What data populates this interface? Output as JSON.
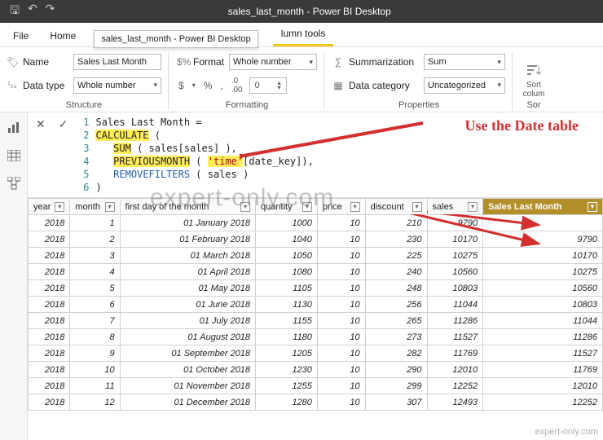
{
  "titlebar": {
    "title": "sales_last_month - Power BI Desktop"
  },
  "menu": {
    "file": "File",
    "home": "Home",
    "tooltip": "sales_last_month - Power BI Desktop",
    "active_tab": "lumn tools"
  },
  "ribbon": {
    "structure": {
      "name_label": "Name",
      "name_value": "Sales Last Month",
      "datatype_label": "Data type",
      "datatype_value": "Whole number",
      "group": "Structure"
    },
    "formatting": {
      "format_label": "Format",
      "format_value": "Whole number",
      "decimals": "0",
      "group": "Formatting"
    },
    "properties": {
      "summarization_label": "Summarization",
      "summarization_value": "Sum",
      "datacategory_label": "Data category",
      "datacategory_value": "Uncategorized",
      "group": "Properties"
    },
    "sort": {
      "line1": "Sort",
      "line2": "colum",
      "group": "Sor"
    }
  },
  "formula": {
    "lines": {
      "l1": "Sales Last Month =",
      "l2a": "CALCULATE",
      "l2b": " (",
      "l3a": "SUM",
      "l3b": " ( sales[sales] ),",
      "l4a": "PREVIOUSMONTH",
      "l4b": " ( ",
      "l4c": "'time'",
      "l4d": "[date_key]),",
      "l5a": "REMOVEFILTERS",
      "l5b": " ( sales )",
      "l6": ")"
    }
  },
  "annotation": "Use the Date table",
  "watermark": "expert-only.com",
  "grid": {
    "headers": [
      "year",
      "month",
      "first day of the month",
      "quantity",
      "price",
      "discount",
      "sales",
      "Sales Last Month"
    ],
    "rows": [
      {
        "year": "2018",
        "month": "1",
        "fdm": "01 January 2018",
        "qty": "1000",
        "price": "10",
        "disc": "210",
        "sales": "9790",
        "slm": ""
      },
      {
        "year": "2018",
        "month": "2",
        "fdm": "01 February 2018",
        "qty": "1040",
        "price": "10",
        "disc": "230",
        "sales": "10170",
        "slm": "9790"
      },
      {
        "year": "2018",
        "month": "3",
        "fdm": "01 March 2018",
        "qty": "1050",
        "price": "10",
        "disc": "225",
        "sales": "10275",
        "slm": "10170"
      },
      {
        "year": "2018",
        "month": "4",
        "fdm": "01 April 2018",
        "qty": "1080",
        "price": "10",
        "disc": "240",
        "sales": "10560",
        "slm": "10275"
      },
      {
        "year": "2018",
        "month": "5",
        "fdm": "01 May 2018",
        "qty": "1105",
        "price": "10",
        "disc": "248",
        "sales": "10803",
        "slm": "10560"
      },
      {
        "year": "2018",
        "month": "6",
        "fdm": "01 June 2018",
        "qty": "1130",
        "price": "10",
        "disc": "256",
        "sales": "11044",
        "slm": "10803"
      },
      {
        "year": "2018",
        "month": "7",
        "fdm": "01 July 2018",
        "qty": "1155",
        "price": "10",
        "disc": "265",
        "sales": "11286",
        "slm": "11044"
      },
      {
        "year": "2018",
        "month": "8",
        "fdm": "01 August 2018",
        "qty": "1180",
        "price": "10",
        "disc": "273",
        "sales": "11527",
        "slm": "11286"
      },
      {
        "year": "2018",
        "month": "9",
        "fdm": "01 September 2018",
        "qty": "1205",
        "price": "10",
        "disc": "282",
        "sales": "11769",
        "slm": "11527"
      },
      {
        "year": "2018",
        "month": "10",
        "fdm": "01 October 2018",
        "qty": "1230",
        "price": "10",
        "disc": "290",
        "sales": "12010",
        "slm": "11769"
      },
      {
        "year": "2018",
        "month": "11",
        "fdm": "01 November 2018",
        "qty": "1255",
        "price": "10",
        "disc": "299",
        "sales": "12252",
        "slm": "12010"
      },
      {
        "year": "2018",
        "month": "12",
        "fdm": "01 December 2018",
        "qty": "1280",
        "price": "10",
        "disc": "307",
        "sales": "12493",
        "slm": "12252"
      }
    ]
  }
}
